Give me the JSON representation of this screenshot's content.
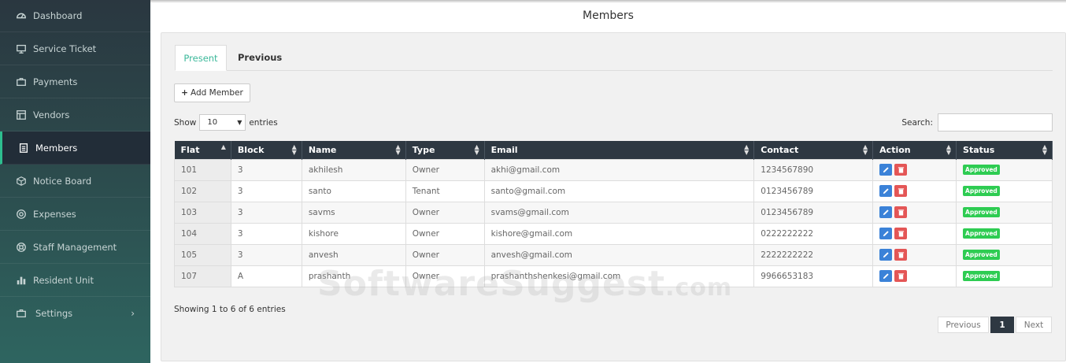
{
  "sidebar": {
    "items": [
      {
        "label": "Dashboard",
        "icon": "dashboard-icon"
      },
      {
        "label": "Service Ticket",
        "icon": "monitor-icon"
      },
      {
        "label": "Payments",
        "icon": "briefcase-icon"
      },
      {
        "label": "Vendors",
        "icon": "layout-icon"
      },
      {
        "label": "Members",
        "icon": "document-icon",
        "active": true
      },
      {
        "label": "Notice Board",
        "icon": "cube-icon"
      },
      {
        "label": "Expenses",
        "icon": "target-icon"
      },
      {
        "label": "Staff Management",
        "icon": "lifebuoy-icon"
      },
      {
        "label": "Resident Unit",
        "icon": "bar-chart-icon"
      },
      {
        "label": "Settings",
        "icon": "briefcase-icon",
        "chevron": "›"
      }
    ]
  },
  "page": {
    "title": "Members"
  },
  "tabs": [
    {
      "label": "Present",
      "active": true
    },
    {
      "label": "Previous",
      "active": false
    }
  ],
  "toolbar": {
    "add_member_label": "Add Member"
  },
  "length_control": {
    "show_label": "Show",
    "value": "10",
    "entries_label": "entries"
  },
  "search": {
    "label": "Search:",
    "value": ""
  },
  "table": {
    "columns": [
      "Flat",
      "Block",
      "Name",
      "Type",
      "Email",
      "Contact",
      "Action",
      "Status"
    ],
    "rows": [
      {
        "flat": "101",
        "block": "3",
        "name": "akhilesh",
        "type": "Owner",
        "email": "akhi@gmail.com",
        "contact": "1234567890",
        "status": "Approved"
      },
      {
        "flat": "102",
        "block": "3",
        "name": "santo",
        "type": "Tenant",
        "email": "santo@gmail.com",
        "contact": "0123456789",
        "status": "Approved"
      },
      {
        "flat": "103",
        "block": "3",
        "name": "savms",
        "type": "Owner",
        "email": "svams@gmail.com",
        "contact": "0123456789",
        "status": "Approved"
      },
      {
        "flat": "104",
        "block": "3",
        "name": "kishore",
        "type": "Owner",
        "email": "kishore@gmail.com",
        "contact": "0222222222",
        "status": "Approved"
      },
      {
        "flat": "105",
        "block": "3",
        "name": "anvesh",
        "type": "Owner",
        "email": "anvesh@gmail.com",
        "contact": "2222222222",
        "status": "Approved"
      },
      {
        "flat": "107",
        "block": "A",
        "name": "prashanth",
        "type": "Owner",
        "email": "prashanthshenkesi@gmail.com",
        "contact": "9966653183",
        "status": "Approved"
      }
    ]
  },
  "footer": {
    "info": "Showing 1 to 6 of 6 entries"
  },
  "pagination": {
    "prev": "Previous",
    "current": "1",
    "next": "Next"
  },
  "watermark": {
    "text": "SoftwareSuggest",
    "suffix": ".com"
  },
  "colors": {
    "accent": "#3bb89a",
    "header": "#2e3842",
    "approved": "#2ecc52",
    "edit": "#3b82d8",
    "delete": "#e45656"
  }
}
